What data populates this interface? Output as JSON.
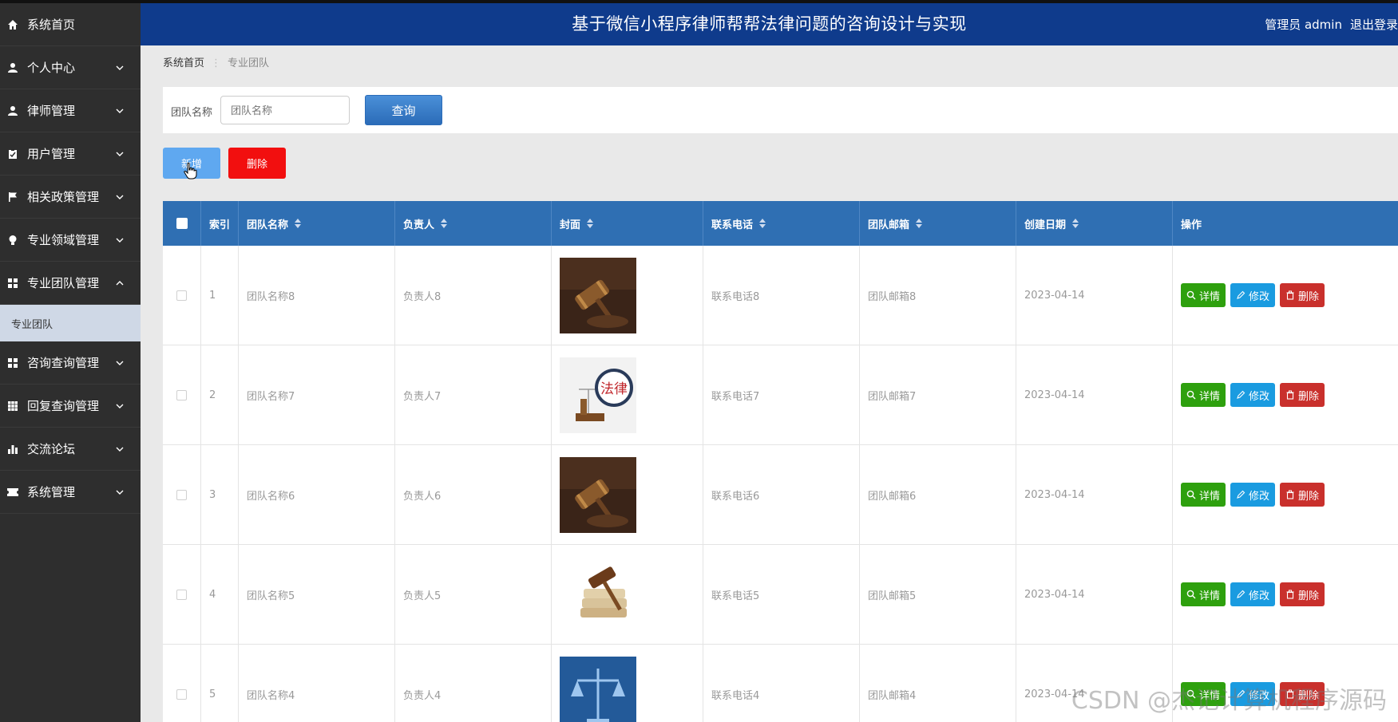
{
  "app": {
    "title": "基于微信小程序律师帮帮法律问题的咨询设计与实现",
    "user_label": "管理员 admin",
    "logout_label": "退出登录"
  },
  "sidebar": {
    "items": [
      {
        "label": "系统首页",
        "icon": "home-icon"
      },
      {
        "label": "个人中心",
        "icon": "user-icon"
      },
      {
        "label": "律师管理",
        "icon": "user-icon"
      },
      {
        "label": "用户管理",
        "icon": "clipboard-icon"
      },
      {
        "label": "相关政策管理",
        "icon": "flag-icon"
      },
      {
        "label": "专业领域管理",
        "icon": "bulb-icon"
      },
      {
        "label": "专业团队管理",
        "icon": "grid-icon"
      },
      {
        "label": "咨询查询管理",
        "icon": "grid-icon"
      },
      {
        "label": "回复查询管理",
        "icon": "grid-icon"
      },
      {
        "label": "交流论坛",
        "icon": "bar-chart-icon"
      },
      {
        "label": "系统管理",
        "icon": "ticket-icon"
      }
    ],
    "active_sub": "专业团队"
  },
  "breadcrumb": {
    "home": "系统首页",
    "current": "专业团队"
  },
  "search": {
    "label": "团队名称",
    "placeholder": "团队名称",
    "button": "查询"
  },
  "actions": {
    "add": "新增",
    "delete": "删除"
  },
  "table": {
    "headers": [
      "索引",
      "团队名称",
      "负责人",
      "封面",
      "联系电话",
      "团队邮箱",
      "创建日期",
      "操作"
    ],
    "op_labels": {
      "detail": "详情",
      "edit": "修改",
      "delete": "删除"
    },
    "rows": [
      {
        "index": "1",
        "name": "团队名称8",
        "owner": "负责人8",
        "cover": "gavel-dark",
        "phone": "联系电话8",
        "email": "团队邮箱8",
        "date": "2023-04-14"
      },
      {
        "index": "2",
        "name": "团队名称7",
        "owner": "负责人7",
        "cover": "law-magnifier",
        "phone": "联系电话7",
        "email": "团队邮箱7",
        "date": "2023-04-14"
      },
      {
        "index": "3",
        "name": "团队名称6",
        "owner": "负责人6",
        "cover": "gavel-dark",
        "phone": "联系电话6",
        "email": "团队邮箱6",
        "date": "2023-04-14"
      },
      {
        "index": "4",
        "name": "团队名称5",
        "owner": "负责人5",
        "cover": "gavel-books",
        "phone": "联系电话5",
        "email": "团队邮箱5",
        "date": "2023-04-14"
      },
      {
        "index": "5",
        "name": "团队名称4",
        "owner": "负责人4",
        "cover": "scales-blue",
        "phone": "联系电话4",
        "email": "团队邮箱4",
        "date": "2023-04-14"
      }
    ]
  },
  "cover_text": "法律",
  "watermark": "CSDN @杰记计算机程序源码",
  "colors": {
    "header": "#0f3b8c",
    "sidebar": "#2e2e2e",
    "table_head": "#2f6fb3",
    "detail": "#2ea00e",
    "edit": "#1a9be0",
    "delete": "#c9302c"
  }
}
